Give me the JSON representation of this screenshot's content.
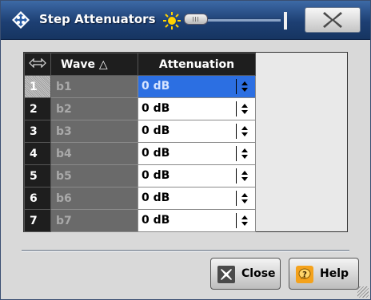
{
  "window": {
    "title": "Step Attenuators"
  },
  "icons": {
    "app": "app-diamond-icon",
    "brightness": "sun-icon",
    "close": "close-x-icon",
    "help": "help-question-icon"
  },
  "colors": {
    "titlebar": "#1d3f73",
    "selected_cell": "#2c6fe2",
    "header": "#1e1e1e"
  },
  "grid": {
    "headers": {
      "wave": "Wave △",
      "attenuation": "Attenuation"
    },
    "rows": [
      {
        "num": "1",
        "wave": "b1",
        "attenuation": "0 dB"
      },
      {
        "num": "2",
        "wave": "b2",
        "attenuation": "0 dB"
      },
      {
        "num": "3",
        "wave": "b3",
        "attenuation": "0 dB"
      },
      {
        "num": "4",
        "wave": "b4",
        "attenuation": "0 dB"
      },
      {
        "num": "5",
        "wave": "b5",
        "attenuation": "0 dB"
      },
      {
        "num": "6",
        "wave": "b6",
        "attenuation": "0 dB"
      },
      {
        "num": "7",
        "wave": "b7",
        "attenuation": "0 dB"
      }
    ]
  },
  "buttons": {
    "close_label": "Close",
    "help_label": "Help"
  }
}
